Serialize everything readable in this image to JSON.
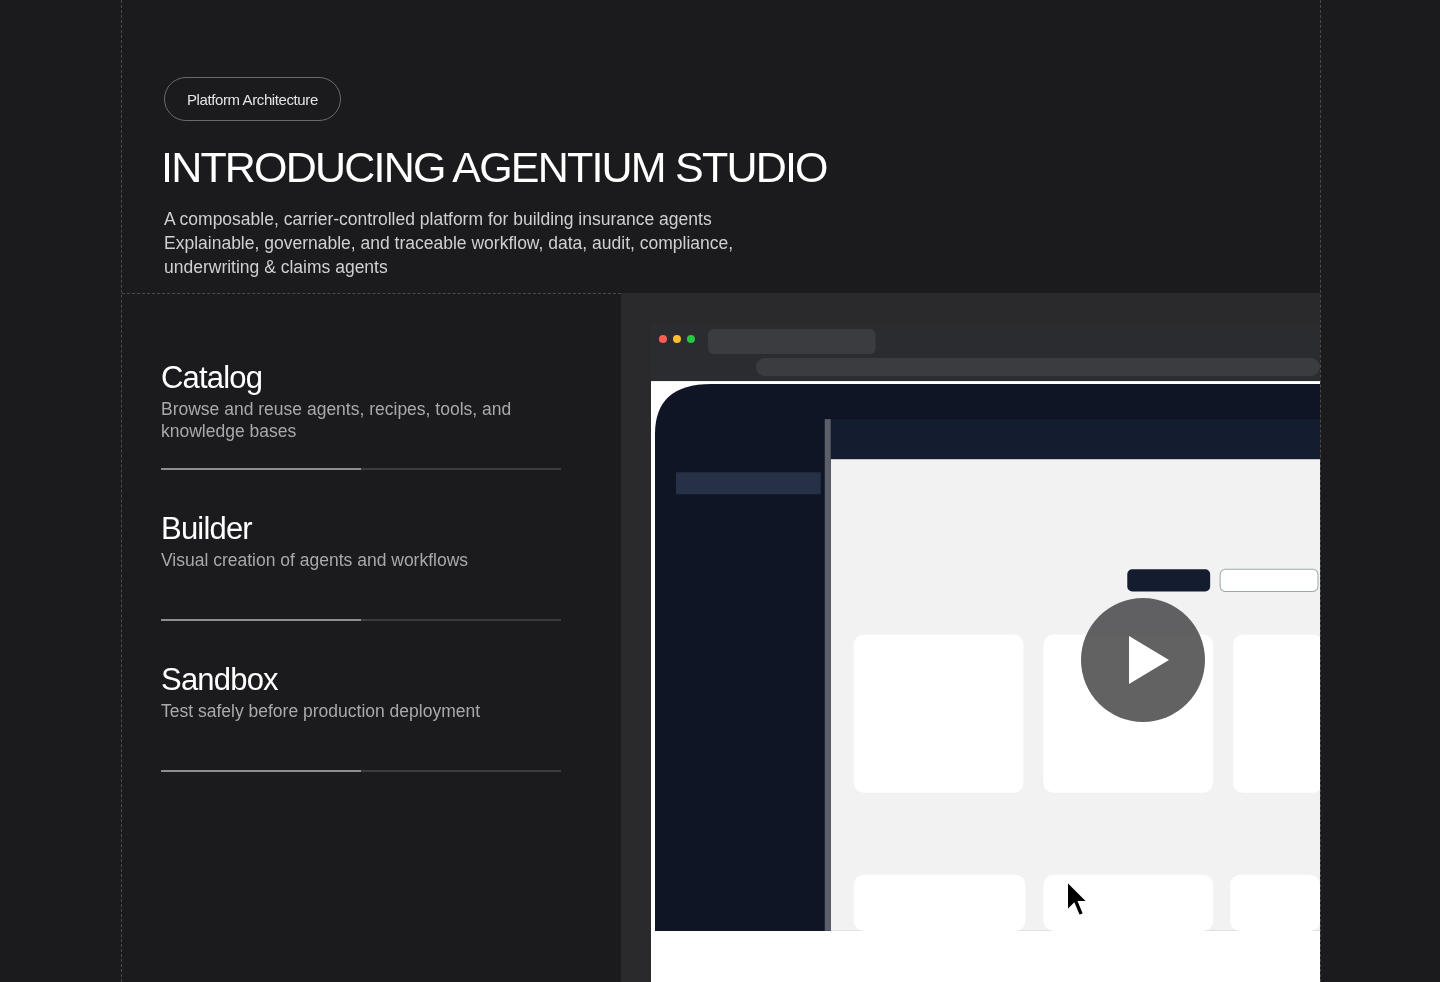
{
  "badge": "Platform Architecture",
  "title": "INTRODUCING AGENTIUM STUDIO",
  "description": [
    "A composable, carrier-controlled platform for building insurance agents",
    "Explainable, governable, and traceable workflow, data, audit, compliance, underwriting & claims agents"
  ],
  "features": [
    {
      "title": "Catalog",
      "description": "Browse and reuse agents, recipes, tools, and knowledge bases",
      "level": 0.5
    },
    {
      "title": "Builder",
      "description": "Visual creation of agents and workflows",
      "level": 0.5
    },
    {
      "title": "Sandbox",
      "description": "Test safely before production deployment",
      "level": 0.5
    }
  ],
  "video": {
    "kind": "picture"
  }
}
